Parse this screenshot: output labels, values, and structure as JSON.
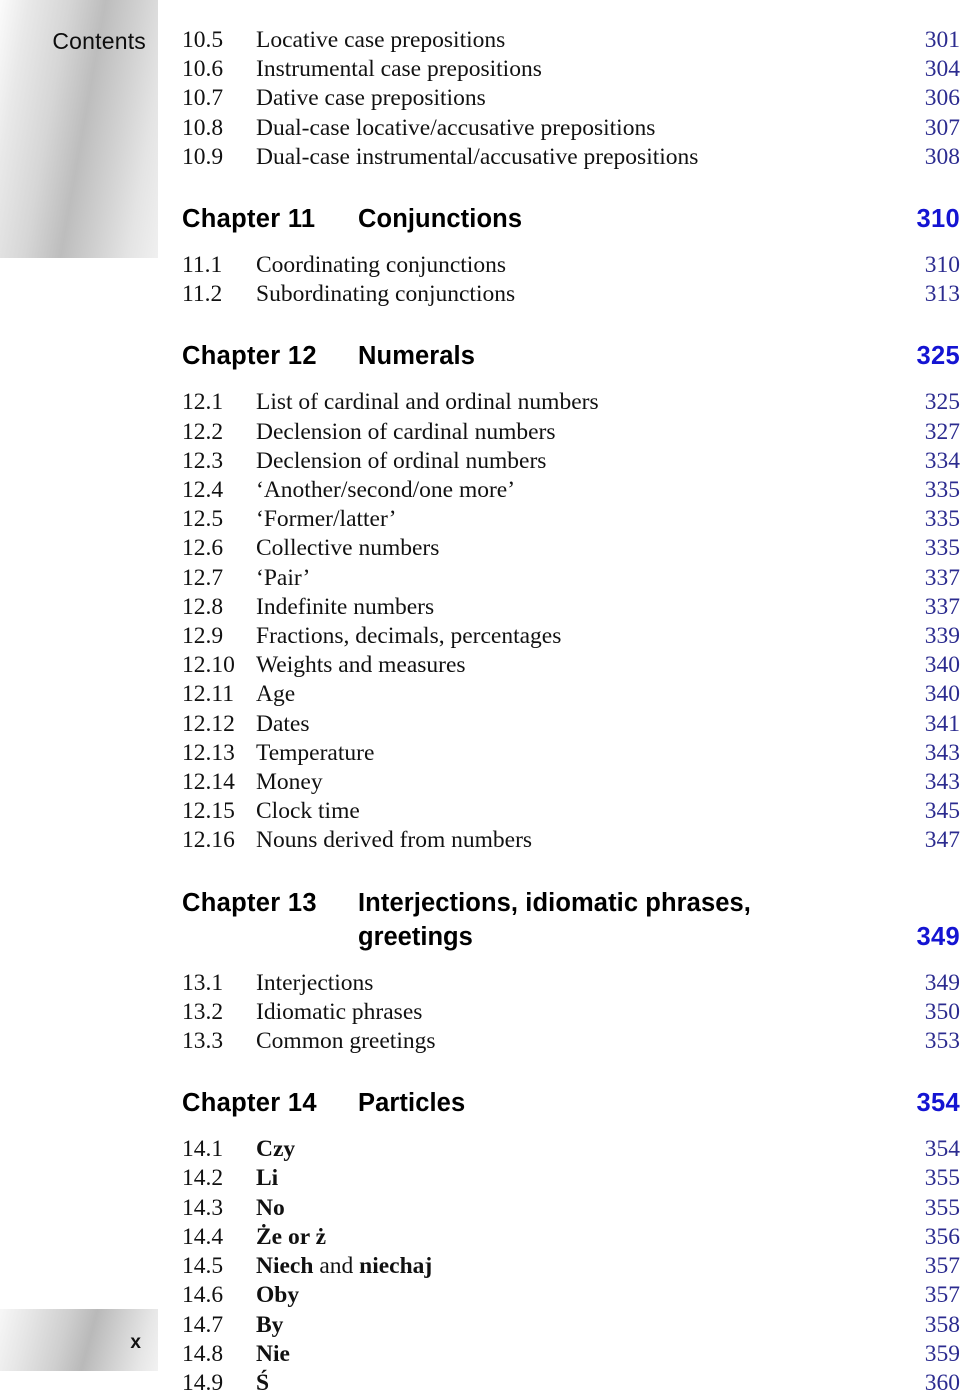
{
  "running_head": "Contents",
  "folio": "x",
  "colors": {
    "chapter_page": "#1414d2",
    "section_page": "#2b2b8f",
    "text": "#111111"
  },
  "groups": [
    {
      "id": "chapter-10-tail",
      "sections": [
        {
          "num": "10.5",
          "title": "Locative case prepositions",
          "page": "301"
        },
        {
          "num": "10.6",
          "title": "Instrumental case prepositions",
          "page": "304"
        },
        {
          "num": "10.7",
          "title": "Dative case prepositions",
          "page": "306"
        },
        {
          "num": "10.8",
          "title": "Dual-case locative/accusative prepositions",
          "page": "307"
        },
        {
          "num": "10.9",
          "title": "Dual-case instrumental/accusative prepositions",
          "page": "308"
        }
      ]
    },
    {
      "id": "chapter-11",
      "chapter": {
        "num": "Chapter 11",
        "title": "Conjunctions",
        "page": "310"
      },
      "sections": [
        {
          "num": "11.1",
          "title": "Coordinating conjunctions",
          "page": "310"
        },
        {
          "num": "11.2",
          "title": "Subordinating conjunctions",
          "page": "313"
        }
      ]
    },
    {
      "id": "chapter-12",
      "chapter": {
        "num": "Chapter 12",
        "title": "Numerals",
        "page": "325"
      },
      "sections": [
        {
          "num": "12.1",
          "title": "List of cardinal and ordinal numbers",
          "page": "325"
        },
        {
          "num": "12.2",
          "title": "Declension of cardinal numbers",
          "page": "327"
        },
        {
          "num": "12.3",
          "title": "Declension of ordinal numbers",
          "page": "334"
        },
        {
          "num": "12.4",
          "title": "‘Another/second/one more’",
          "page": "335"
        },
        {
          "num": "12.5",
          "title": "‘Former/latter’",
          "page": "335"
        },
        {
          "num": "12.6",
          "title": "Collective numbers",
          "page": "335"
        },
        {
          "num": "12.7",
          "title": "‘Pair’",
          "page": "337"
        },
        {
          "num": "12.8",
          "title": "Indefinite numbers",
          "page": "337"
        },
        {
          "num": "12.9",
          "title": "Fractions, decimals, percentages",
          "page": "339"
        },
        {
          "num": "12.10",
          "title": "Weights and measures",
          "page": "340"
        },
        {
          "num": "12.11",
          "title": "Age",
          "page": "340"
        },
        {
          "num": "12.12",
          "title": "Dates",
          "page": "341"
        },
        {
          "num": "12.13",
          "title": "Temperature",
          "page": "343"
        },
        {
          "num": "12.14",
          "title": "Money",
          "page": "343"
        },
        {
          "num": "12.15",
          "title": "Clock time",
          "page": "345"
        },
        {
          "num": "12.16",
          "title": "Nouns derived from numbers",
          "page": "347"
        }
      ]
    },
    {
      "id": "chapter-13",
      "chapter": {
        "num": "Chapter 13",
        "title": "Interjections, idiomatic phrases,",
        "title_line2": "greetings",
        "page": "349"
      },
      "sections": [
        {
          "num": "13.1",
          "title": "Interjections",
          "page": "349"
        },
        {
          "num": "13.2",
          "title": "Idiomatic phrases",
          "page": "350"
        },
        {
          "num": "13.3",
          "title": "Common greetings",
          "page": "353"
        }
      ]
    },
    {
      "id": "chapter-14",
      "chapter": {
        "num": "Chapter 14",
        "title": "Particles",
        "page": "354"
      },
      "sections": [
        {
          "num": "14.1",
          "title": "Czy",
          "page": "354",
          "headword": true
        },
        {
          "num": "14.2",
          "title": "Li",
          "page": "355",
          "headword": true
        },
        {
          "num": "14.3",
          "title": "No",
          "page": "355",
          "headword": true
        },
        {
          "num": "14.4",
          "title": "Że or ż",
          "page": "356",
          "headword": true
        },
        {
          "num": "14.5",
          "title": "Niech and niechaj",
          "page": "357",
          "headword": "mixed",
          "parts": [
            {
              "text": "Niech",
              "bold": true
            },
            {
              "text": " and ",
              "bold": false
            },
            {
              "text": "niechaj",
              "bold": true
            }
          ]
        },
        {
          "num": "14.6",
          "title": "Oby",
          "page": "357",
          "headword": true
        },
        {
          "num": "14.7",
          "title": "By",
          "page": "358",
          "headword": true
        },
        {
          "num": "14.8",
          "title": "Nie",
          "page": "359",
          "headword": true
        },
        {
          "num": "14.9",
          "title": "Ś",
          "page": "360",
          "headword": true
        }
      ]
    }
  ]
}
